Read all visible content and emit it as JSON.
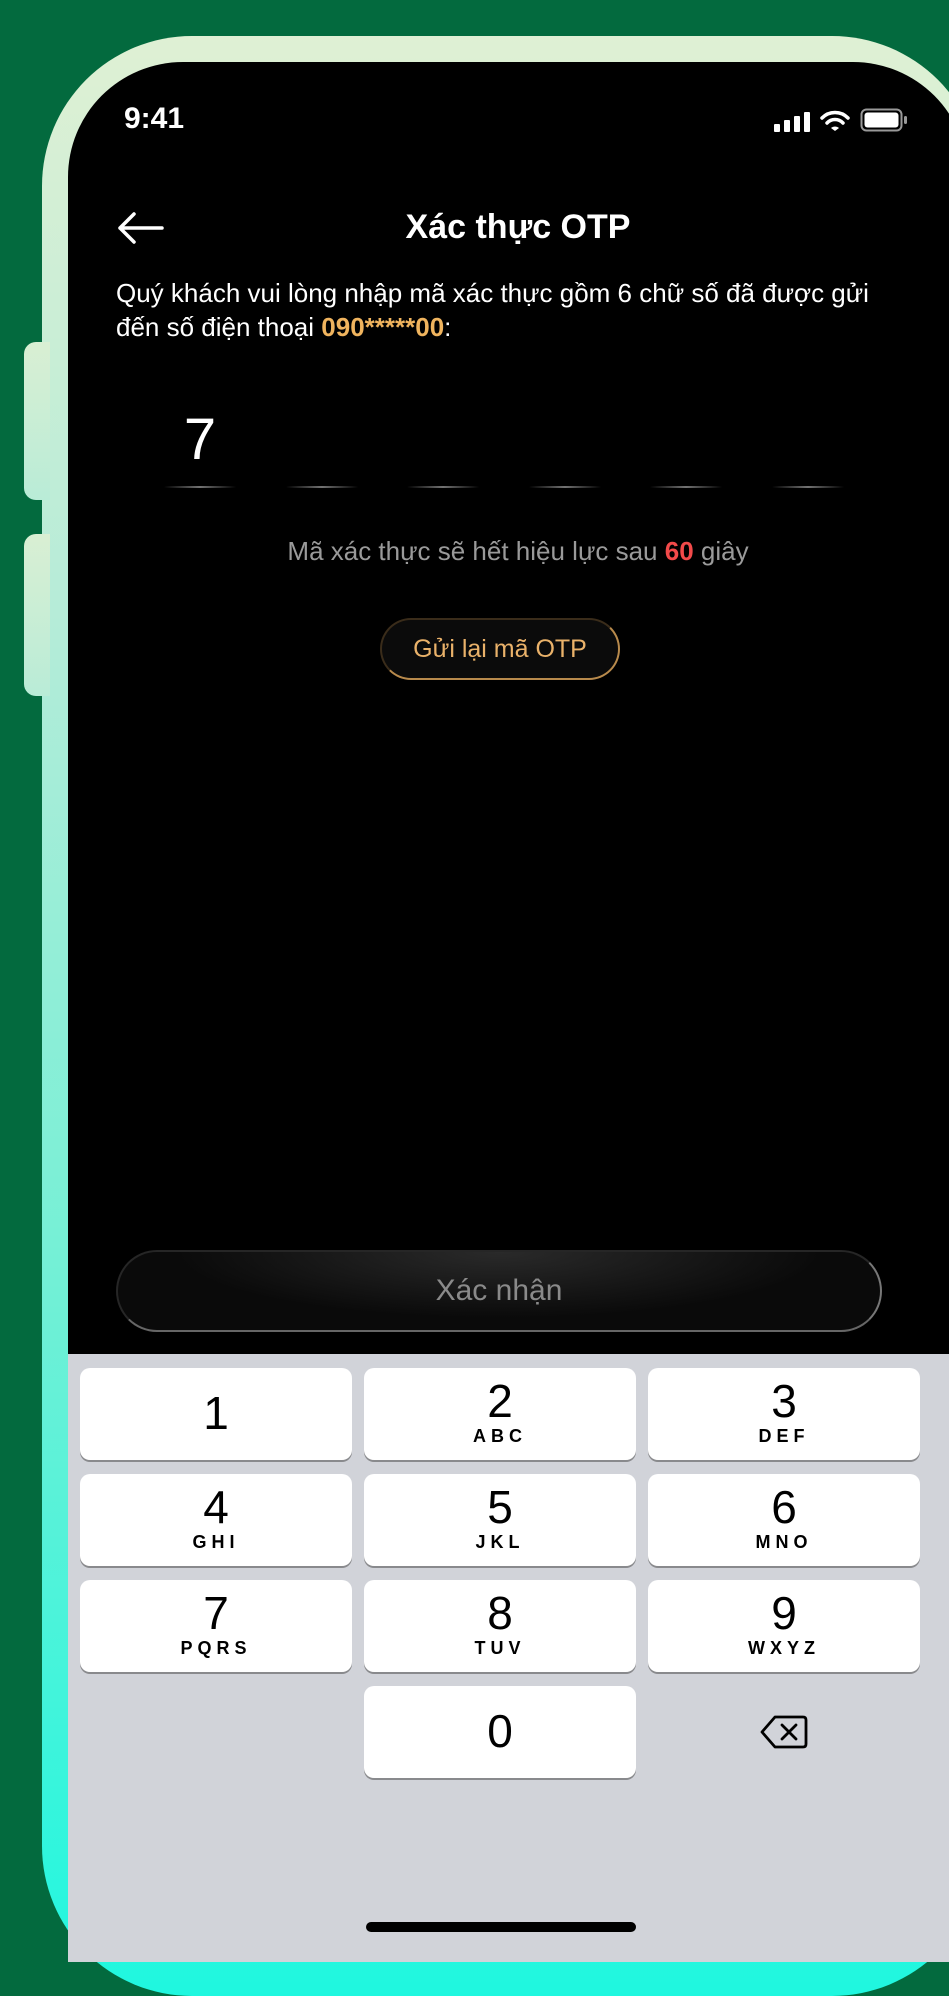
{
  "status_bar": {
    "time": "9:41"
  },
  "header": {
    "title": "Xác thực OTP"
  },
  "description": {
    "text": "Quý khách vui lòng nhập mã xác thực gồm 6 chữ số đã được gửi đến số điện thoại ",
    "phone": "090*****00",
    "suffix": ":"
  },
  "otp": {
    "digits": [
      "7",
      "",
      "",
      "",
      "",
      ""
    ]
  },
  "expiry": {
    "prefix": "Mã xác thực sẽ hết hiệu lực sau ",
    "seconds": "60",
    "suffix": " giây"
  },
  "resend_label": "Gửi lại mã OTP",
  "confirm_label": "Xác nhận",
  "keypad": [
    {
      "num": "1",
      "letters": ""
    },
    {
      "num": "2",
      "letters": "ABC"
    },
    {
      "num": "3",
      "letters": "DEF"
    },
    {
      "num": "4",
      "letters": "GHI"
    },
    {
      "num": "5",
      "letters": "JKL"
    },
    {
      "num": "6",
      "letters": "MNO"
    },
    {
      "num": "7",
      "letters": "PQRS"
    },
    {
      "num": "8",
      "letters": "TUV"
    },
    {
      "num": "9",
      "letters": "WXYZ"
    },
    {
      "num": "0",
      "letters": ""
    }
  ],
  "colors": {
    "accent_gold": "#f0b45e",
    "countdown_red": "#f24a4a",
    "frame_green": "#036a3e"
  },
  "icons": [
    "back-arrow-icon",
    "signal-icon",
    "wifi-icon",
    "battery-icon",
    "delete-icon"
  ]
}
